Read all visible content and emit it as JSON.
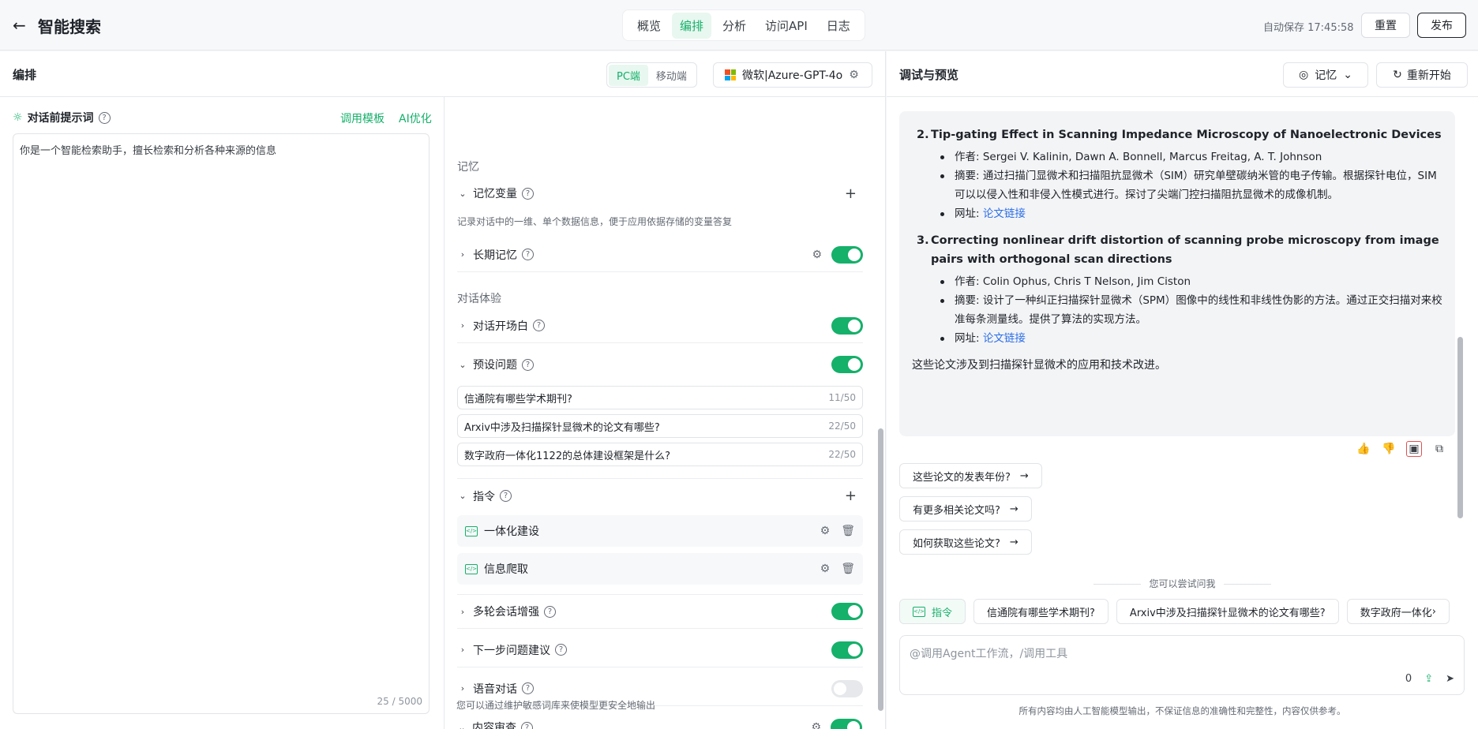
{
  "header": {
    "title": "智能搜索",
    "tabs": [
      {
        "label": "概览"
      },
      {
        "label": "编排"
      },
      {
        "label": "分析"
      },
      {
        "label": "访问API"
      },
      {
        "label": "日志"
      }
    ],
    "autosave": "自动保存 17:45:58",
    "reset_label": "重置",
    "publish_label": "发布",
    "accent_color": "#15b06a"
  },
  "editor": {
    "title": "编排",
    "platforms": [
      "PC端",
      "移动端"
    ],
    "model": "微软|Azure-GPT-4o",
    "prompt": {
      "label": "对话前提示词",
      "template_link": "调用模板",
      "ai_link": "AI优化",
      "text": "你是一个智能检索助手，擅长检索和分析各种来源的信息",
      "count": "25 / 5000"
    }
  },
  "config": {
    "memory_group": "记忆",
    "memory_var": {
      "label": "记忆变量",
      "desc": "记录对话中的一维、单个数据信息，便于应用依据存储的变量答复"
    },
    "long_memory": {
      "label": "长期记忆"
    },
    "chat_group": "对话体验",
    "opening": {
      "label": "对话开场白"
    },
    "preset": {
      "label": "预设问题",
      "questions": [
        {
          "text": "信通院有哪些学术期刊?",
          "count": "11/50"
        },
        {
          "text": "Arxiv中涉及扫描探针显微术的论文有哪些?",
          "count": "22/50"
        },
        {
          "text": "数字政府一体化1122的总体建设框架是什么?",
          "count": "22/50"
        }
      ]
    },
    "commands": {
      "label": "指令",
      "items": [
        {
          "label": "一体化建设"
        },
        {
          "label": "信息爬取"
        }
      ]
    },
    "multi_turn": {
      "label": "多轮会话增强"
    },
    "next_suggest": {
      "label": "下一步问题建议"
    },
    "voice": {
      "label": "语音对话"
    },
    "review": {
      "label": "内容审查",
      "desc": "您可以通过维护敏感词库来使模型更安全地输出"
    }
  },
  "preview": {
    "title": "调试与预览",
    "memory_btn": "记忆",
    "restart_btn": "重新开始",
    "papers": [
      {
        "num": "2.",
        "title": "Tip-gating Effect in Scanning Impedance Microscopy of Nanoelectronic Devices",
        "authors": "作者: Sergei V. Kalinin, Dawn A. Bonnell, Marcus Freitag, A. T. Johnson",
        "summary": "摘要: 通过扫描门显微术和扫描阻抗显微术（SIM）研究单壁碳纳米管的电子传输。根据探针电位，SIM可以以侵入性和非侵入性模式进行。探讨了尖端门控扫描阻抗显微术的成像机制。",
        "url_label": "网址: ",
        "url_text": "论文链接"
      },
      {
        "num": "3.",
        "title": "Correcting nonlinear drift distortion of scanning probe microscopy from image pairs with orthogonal scan directions",
        "authors": "作者: Colin Ophus, Chris T Nelson, Jim Ciston",
        "summary": "摘要: 设计了一种纠正扫描探针显微术（SPM）图像中的线性和非线性伪影的方法。通过正交扫描对来校准每条测量线。提供了算法的实现方法。",
        "url_label": "网址: ",
        "url_text": "论文链接"
      }
    ],
    "conclusion": "这些论文涉及到扫描探针显微术的应用和技术改进。",
    "suggestions": [
      "这些论文的发表年份?",
      "有更多相关论文吗?",
      "如何获取这些论文?"
    ],
    "try_label": "您可以尝试问我",
    "chips": [
      "指令",
      "信通院有哪些学术期刊?",
      "Arxiv中涉及扫描探针显微术的论文有哪些?",
      "数字政府一体化"
    ],
    "input_placeholder": "@调用Agent工作流，/调用工具",
    "input_count": "0",
    "disclaimer": "所有内容均由人工智能模型输出，不保证信息的准确性和完整性，内容仅供参考。",
    "link_color": "#2b6ee8"
  }
}
